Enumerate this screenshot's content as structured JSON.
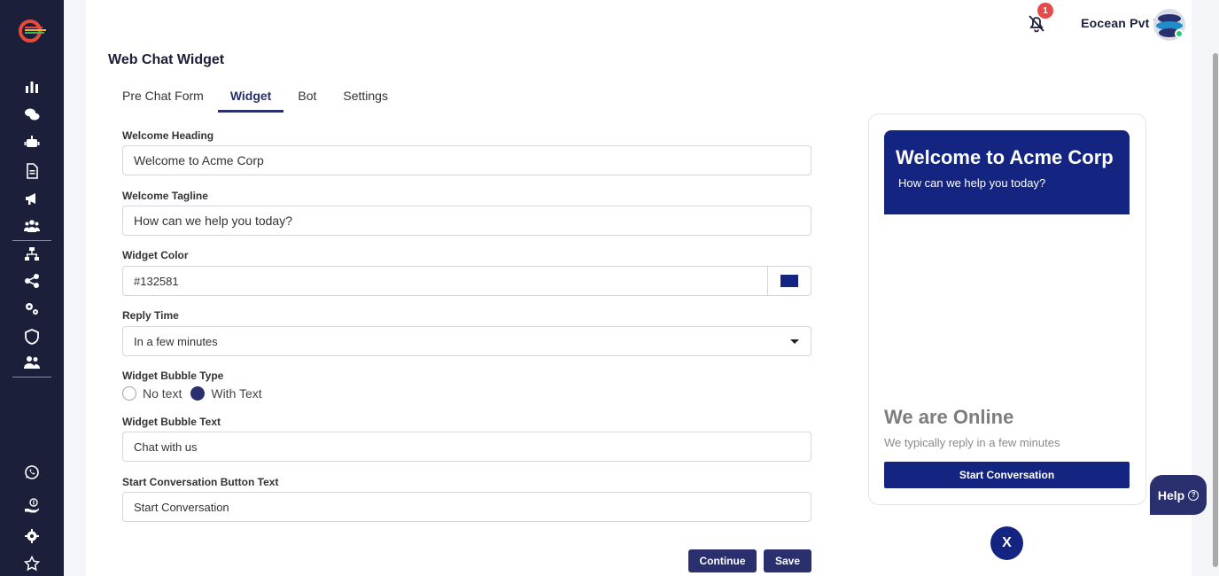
{
  "sidebar": {
    "icons": [
      "dashboard-icon",
      "chats-icon",
      "bot-icon",
      "document-icon",
      "megaphone-icon",
      "team-icon",
      "hierarchy-icon",
      "share-icon",
      "settings-gears-icon",
      "shield-icon",
      "users-icon",
      "whatsapp-icon",
      "billing-icon",
      "settings-icon",
      "star-icon"
    ]
  },
  "header": {
    "company": "Eocean Pvt Ltd",
    "notification_count": "1"
  },
  "page": {
    "title": "Web Chat Widget"
  },
  "tabs": [
    {
      "label": "Pre Chat Form",
      "active": false
    },
    {
      "label": "Widget",
      "active": true
    },
    {
      "label": "Bot",
      "active": false
    },
    {
      "label": "Settings",
      "active": false
    }
  ],
  "form": {
    "welcome_heading": {
      "label": "Welcome Heading",
      "value": "Welcome to Acme Corp"
    },
    "welcome_tagline": {
      "label": "Welcome Tagline",
      "value": "How can we help you today?"
    },
    "widget_color": {
      "label": "Widget Color",
      "value": "#132581"
    },
    "reply_time": {
      "label": "Reply Time",
      "value": "In a few minutes"
    },
    "bubble_type": {
      "label": "Widget Bubble Type",
      "options": [
        "No text",
        "With Text"
      ],
      "selected": "With Text"
    },
    "bubble_text": {
      "label": "Widget Bubble Text",
      "value": "Chat with us"
    },
    "start_button_text": {
      "label": "Start Conversation Button Text",
      "value": "Start Conversation"
    }
  },
  "actions": {
    "continue": "Continue",
    "save": "Save"
  },
  "preview": {
    "heading": "Welcome to Acme Corp",
    "tagline": "How can we help you today?",
    "status": "We are Online",
    "reply_note": "We typically reply in a few minutes",
    "button": "Start Conversation",
    "close": "X"
  },
  "help": {
    "label": "Help",
    "icon": "?"
  },
  "colors": {
    "sidebar": "#1b1f3a",
    "primary": "#2a2f6e",
    "widget": "#132581"
  }
}
